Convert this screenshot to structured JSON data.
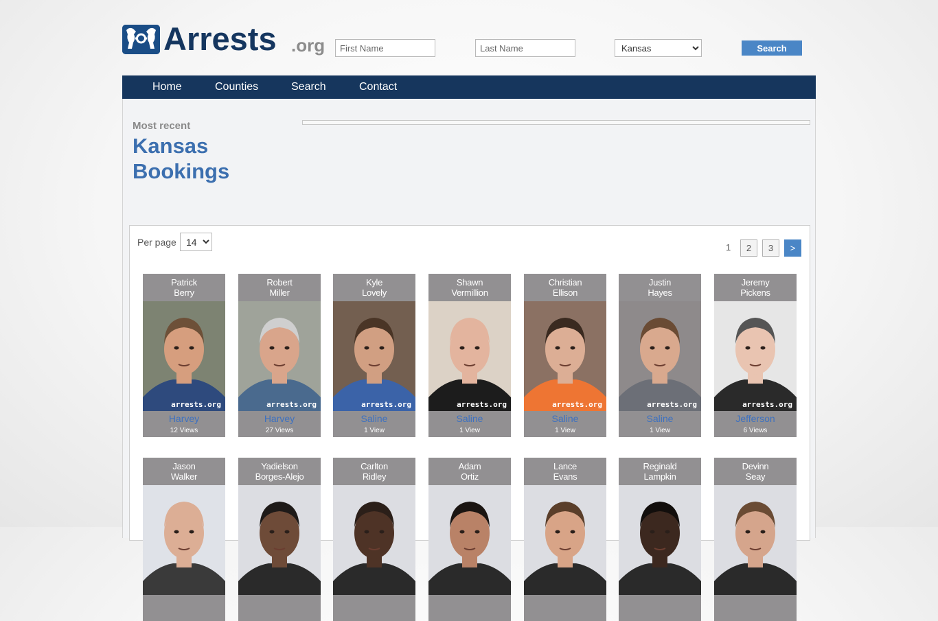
{
  "header": {
    "logo_text": "Arrests",
    "logo_suffix": ".org",
    "first_name_placeholder": "First Name",
    "last_name_placeholder": "Last Name",
    "state_selected": "Kansas",
    "search_label": "Search"
  },
  "nav": {
    "items": [
      {
        "label": "Home"
      },
      {
        "label": "Counties"
      },
      {
        "label": "Search"
      },
      {
        "label": "Contact"
      }
    ]
  },
  "intro": {
    "kicker": "Most recent",
    "title_line1": "Kansas",
    "title_line2": "Bookings"
  },
  "listing": {
    "per_page_label": "Per page",
    "per_page_value": "14",
    "pages": {
      "current": "1",
      "others": [
        "2",
        "3"
      ],
      "next": ">"
    },
    "people": [
      {
        "first": "Patrick",
        "last": "Berry",
        "county": "Harvey",
        "views": "12 Views",
        "watermark": "arrests.org",
        "bg": "#7d8372",
        "skin": "#d69e7e",
        "hair": "#6d5038",
        "shirt": "#2e4a7d"
      },
      {
        "first": "Robert",
        "last": "Miller",
        "county": "Harvey",
        "views": "27 Views",
        "watermark": "arrests.org",
        "bg": "#9fa39a",
        "skin": "#d9a58b",
        "hair": "#cfcfcf",
        "shirt": "#4a6a8e"
      },
      {
        "first": "Kyle",
        "last": "Lovely",
        "county": "Saline",
        "views": "1 View",
        "watermark": "arrests.org",
        "bg": "#735f50",
        "skin": "#d19f82",
        "hair": "#4a3526",
        "shirt": "#3b63a8"
      },
      {
        "first": "Shawn",
        "last": "Vermillion",
        "county": "Saline",
        "views": "1 View",
        "watermark": "arrests.org",
        "bg": "#dcd2c6",
        "skin": "#e3b49e",
        "hair": "#e3b49e",
        "shirt": "#1c1c1c"
      },
      {
        "first": "Christian",
        "last": "Ellison",
        "county": "Saline",
        "views": "1 View",
        "watermark": "arrests.org",
        "bg": "#8b7163",
        "skin": "#dcae95",
        "hair": "#3a2a20",
        "shirt": "#ee7533"
      },
      {
        "first": "Justin",
        "last": "Hayes",
        "county": "Saline",
        "views": "1 View",
        "watermark": "arrests.org",
        "bg": "#8e8a8b",
        "skin": "#d9a98e",
        "hair": "#6a4b34",
        "shirt": "#6c6f77"
      },
      {
        "first": "Jeremy",
        "last": "Pickens",
        "county": "Jefferson",
        "views": "6 Views",
        "watermark": "arrests.org",
        "bg": "#e6e6e6",
        "skin": "#e9c4b1",
        "hair": "#555555",
        "shirt": "#2a2a2a"
      },
      {
        "first": "Jason",
        "last": "Walker",
        "county": "",
        "views": "",
        "watermark": "",
        "bg": "#dfe2e8",
        "skin": "#dcae95",
        "hair": "#dcae95",
        "shirt": "#3a3a3a"
      },
      {
        "first": "Yadielson",
        "last": "Borges-Alejo",
        "county": "",
        "views": "",
        "watermark": "",
        "bg": "#dcdde2",
        "skin": "#6e4b38",
        "hair": "#1e1a18",
        "shirt": "#2a2a2a"
      },
      {
        "first": "Carlton",
        "last": "Ridley",
        "county": "",
        "views": "",
        "watermark": "",
        "bg": "#dcdde2",
        "skin": "#4e3326",
        "hair": "#2b1f19",
        "shirt": "#2a2a2a"
      },
      {
        "first": "Adam",
        "last": "Ortiz",
        "county": "",
        "views": "",
        "watermark": "",
        "bg": "#dcdde2",
        "skin": "#b98267",
        "hair": "#1b1512",
        "shirt": "#2a2a2a"
      },
      {
        "first": "Lance",
        "last": "Evans",
        "county": "",
        "views": "",
        "watermark": "",
        "bg": "#dcdde2",
        "skin": "#d8a487",
        "hair": "#5a3e2a",
        "shirt": "#2a2a2a"
      },
      {
        "first": "Reginald",
        "last": "Lampkin",
        "county": "",
        "views": "",
        "watermark": "",
        "bg": "#dcdde2",
        "skin": "#3c281f",
        "hair": "#120e0c",
        "shirt": "#2a2a2a"
      },
      {
        "first": "Devinn",
        "last": "Seay",
        "county": "",
        "views": "",
        "watermark": "",
        "bg": "#dcdde2",
        "skin": "#d5a58c",
        "hair": "#6a4b34",
        "shirt": "#2a2a2a"
      }
    ]
  },
  "colors": {
    "nav_bg": "#16365d",
    "accent": "#4a86c6",
    "title_blue": "#3c6faf",
    "card_bg": "#929092",
    "county_link": "#3d71c0"
  }
}
